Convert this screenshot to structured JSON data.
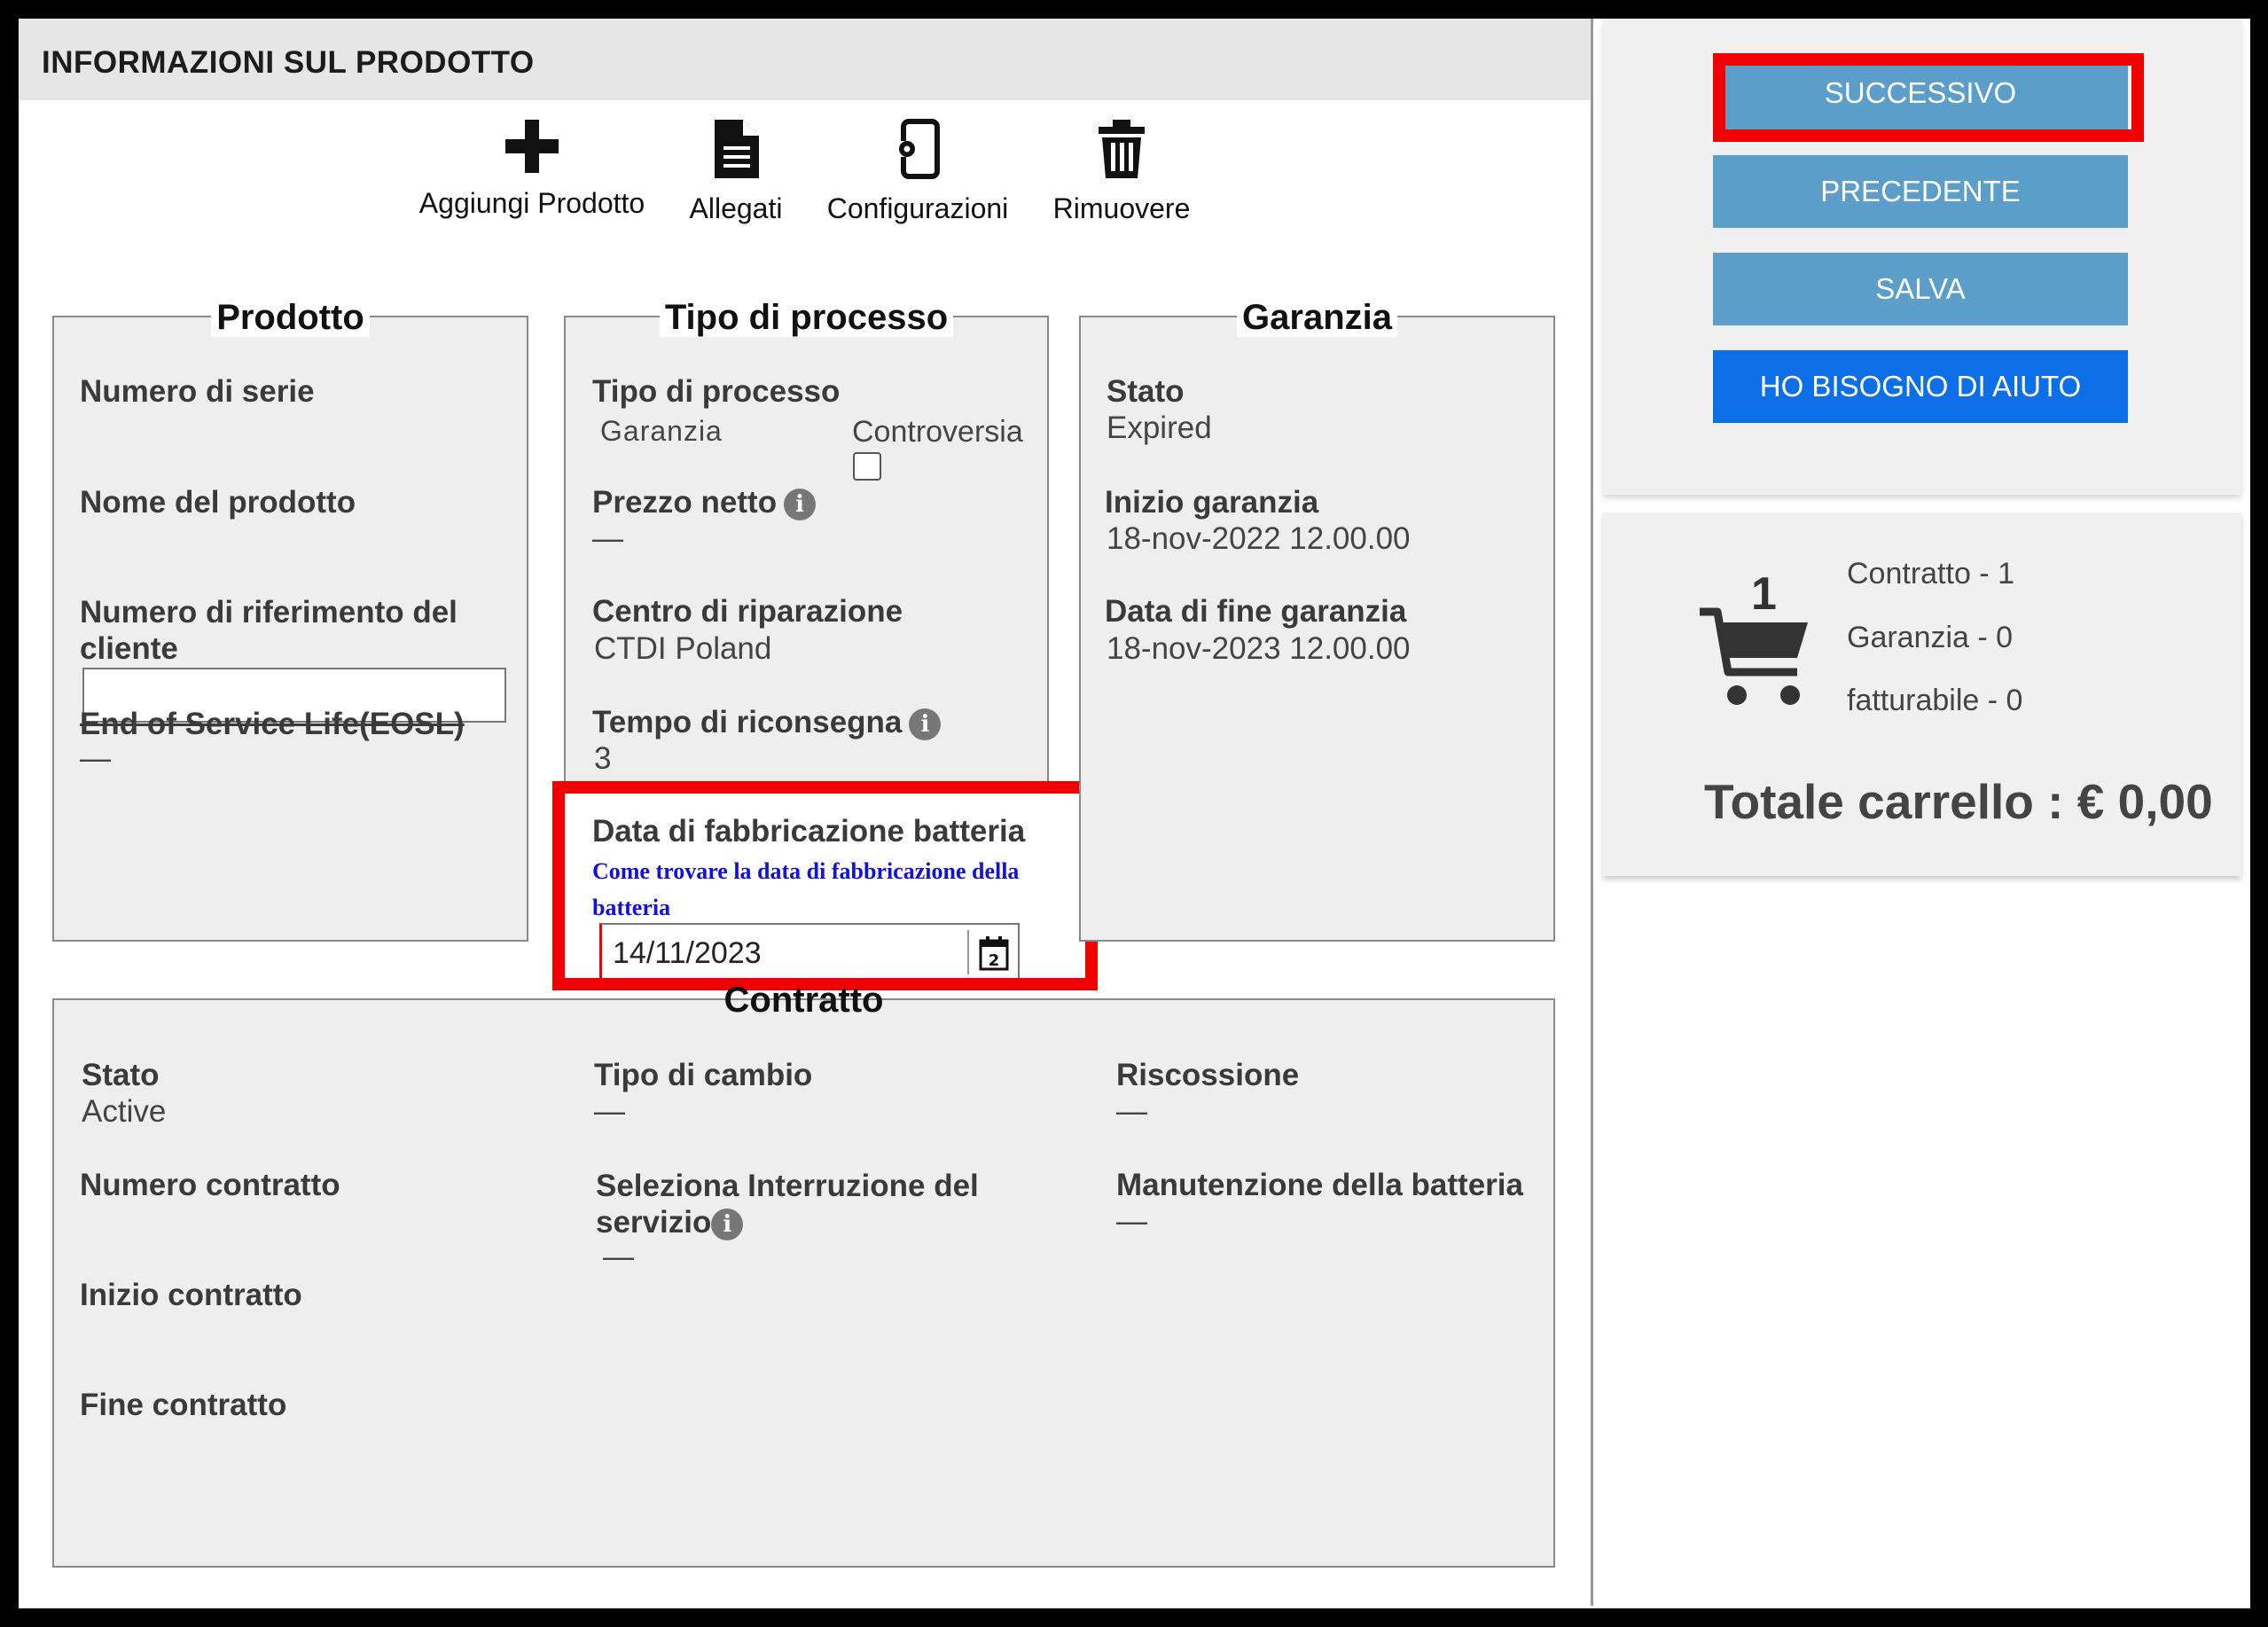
{
  "header": {
    "title": "INFORMAZIONI SUL PRODOTTO"
  },
  "toolbar": [
    {
      "label": "Aggiungi Prodotto",
      "icon": "plus-icon"
    },
    {
      "label": "Allegati",
      "icon": "document-icon"
    },
    {
      "label": "Configurazioni",
      "icon": "configuration-icon"
    },
    {
      "label": "Rimuovere",
      "icon": "trash-icon"
    }
  ],
  "prodotto": {
    "title": "Prodotto",
    "serial_label": "Numero di serie",
    "product_name_label": "Nome del prodotto",
    "customer_ref_label": "Numero di riferimento del cliente",
    "customer_ref_value": "",
    "eosl_label": "End of Service Life(EOSL)",
    "eosl_value": "—"
  },
  "processo": {
    "title": "Tipo di processo",
    "type_label": "Tipo di processo",
    "option_garanzia": "Garanzia",
    "option_controversia": "Controversia",
    "net_price_label": "Prezzo netto",
    "net_price_value": "—",
    "repair_center_label": "Centro di riparazione",
    "repair_center_value": "CTDI Poland",
    "turnaround_label": "Tempo di riconsegna",
    "turnaround_value": "3",
    "battery_date_label": "Data di fabbricazione batteria",
    "battery_help_link": "Come trovare la data di fabbricazione della batteria",
    "battery_date_value": "14/11/2023"
  },
  "garanzia": {
    "title": "Garanzia",
    "status_label": "Stato",
    "status_value": "Expired",
    "start_label": "Inizio garanzia",
    "start_value": "18-nov-2022 12.00.00",
    "end_label": "Data di fine garanzia",
    "end_value": "18-nov-2023 12.00.00"
  },
  "contratto": {
    "title": "Contratto",
    "status_label": "Stato",
    "status_value": "Active",
    "number_label": "Numero contratto",
    "start_label": "Inizio contratto",
    "end_label": "Fine contratto",
    "exchange_label": "Tipo di cambio",
    "exchange_value": "—",
    "interruption_label": "Seleziona Interruzione del servizio",
    "interruption_value": "—",
    "collection_label": "Riscossione",
    "collection_value": "—",
    "battery_maint_label": "Manutenzione della batteria",
    "battery_maint_value": "—"
  },
  "actions": {
    "next": "SUCCESSIVO",
    "previous": "PRECEDENTE",
    "save": "SALVA",
    "help": "HO BISOGNO DI AIUTO"
  },
  "cart": {
    "count": "1",
    "contract_line": "Contratto - 1",
    "warranty_line": "Garanzia - 0",
    "billable_line": "fatturabile - 0",
    "total": "Totale carrello : € 0,00"
  },
  "colors": {
    "accent_button": "#5b9ec9",
    "help_button": "#0d6fe8",
    "highlight": "#f00000",
    "link": "#1010e0"
  }
}
